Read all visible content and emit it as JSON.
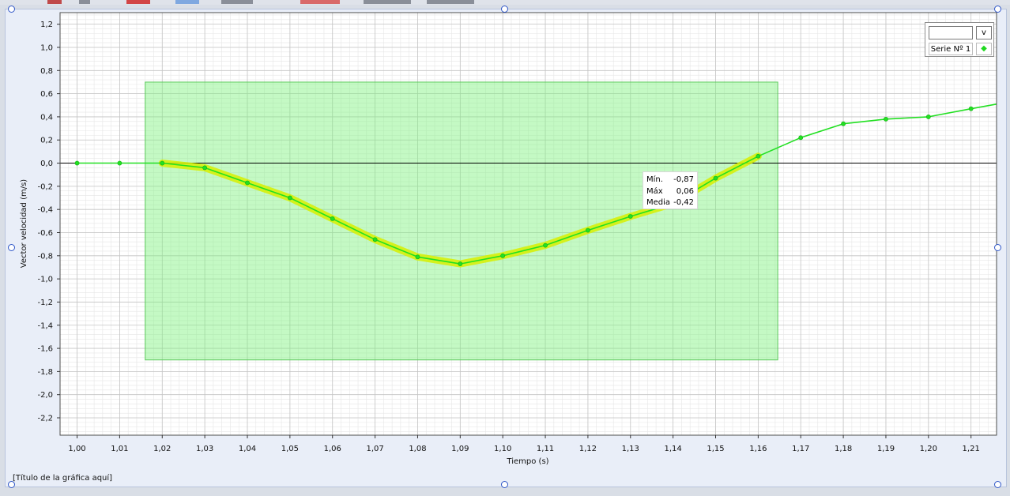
{
  "caption": "[Título de la gráfica aquí]",
  "legend": {
    "dropdown_glyph": "v",
    "series_label": "Serie Nº 1",
    "series_marker": "◆",
    "input_value": ""
  },
  "stats": [
    {
      "label": "Mín.",
      "value": "-0,87"
    },
    {
      "label": "Máx",
      "value": "0,06"
    },
    {
      "label": "Media",
      "value": "-0,42"
    }
  ],
  "colors": {
    "series": "#22e022",
    "highlight": "#d8f000",
    "selection_fill": "#7cf27c",
    "grid_major": "#c4c4c4",
    "grid_minor": "#e6e6e6",
    "handle": "#2f56c7"
  },
  "chart_data": {
    "type": "line",
    "title": "",
    "xlabel": "Tiempo (s)",
    "ylabel": "Vector velocidad (m/s)",
    "xlim": [
      0.996,
      1.216
    ],
    "ylim": [
      -2.35,
      1.3
    ],
    "xticks": [
      "1,00",
      "1,01",
      "1,02",
      "1,03",
      "1,04",
      "1,05",
      "1,06",
      "1,07",
      "1,08",
      "1,09",
      "1,10",
      "1,11",
      "1,12",
      "1,13",
      "1,14",
      "1,15",
      "1,16",
      "1,17",
      "1,18",
      "1,19",
      "1,20",
      "1,21"
    ],
    "yticks": [
      "1,2",
      "1,0",
      "0,8",
      "0,6",
      "0,4",
      "0,2",
      "0,0",
      "-0,2",
      "-0,4",
      "-0,6",
      "-0,8",
      "-1,0",
      "-1,2",
      "-1,4",
      "-1,6",
      "-1,8",
      "-2,0",
      "-2,2"
    ],
    "grid": true,
    "legend_position": "top-right",
    "series": [
      {
        "name": "Serie Nº 1",
        "x": [
          1.0,
          1.01,
          1.02,
          1.03,
          1.04,
          1.05,
          1.06,
          1.07,
          1.08,
          1.09,
          1.1,
          1.11,
          1.12,
          1.13,
          1.14,
          1.15,
          1.16,
          1.17,
          1.18,
          1.19,
          1.2,
          1.21,
          1.216
        ],
        "y": [
          0.0,
          0.0,
          0.0,
          -0.04,
          -0.17,
          -0.3,
          -0.48,
          -0.66,
          -0.81,
          -0.87,
          -0.8,
          -0.71,
          -0.58,
          -0.46,
          -0.35,
          -0.13,
          0.06,
          0.22,
          0.34,
          0.38,
          0.4,
          0.47,
          0.51
        ]
      }
    ],
    "selection": {
      "x_from": 1.016,
      "x_to": 1.1646,
      "y_from": -1.7,
      "y_to": 0.7
    },
    "highlight": {
      "x_from": 1.02,
      "x_to": 1.16
    }
  }
}
